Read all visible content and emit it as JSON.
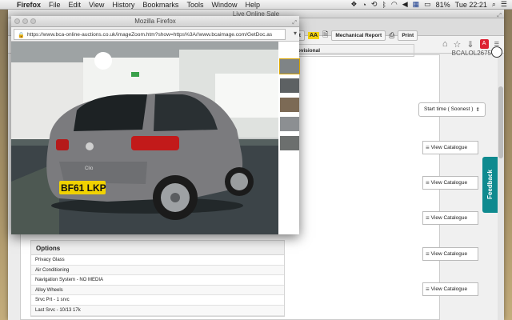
{
  "menubar": {
    "app": "Firefox",
    "items": [
      "File",
      "Edit",
      "View",
      "History",
      "Bookmarks",
      "Tools",
      "Window",
      "Help"
    ],
    "battery": "81%",
    "clock": "Tue 22:21"
  },
  "bg_window": {
    "title": "Live Online Sale",
    "reports": {
      "report_label": "Report",
      "aa_label": "AA",
      "mechanical_label": "Mechanical Report",
      "print_label": "Print"
    },
    "provisional_label": "Provisional",
    "user": "BCALOL2675",
    "sort": "Start time ( Soonest )",
    "catalogue_buttons": [
      "View Catalogue",
      "View Catalogue",
      "View Catalogue",
      "View Catalogue",
      "View Catalogue"
    ],
    "feedback": "Feedback",
    "options": {
      "title": "Options",
      "rows": [
        "Privacy Glass",
        "Air Conditioning",
        "Navigation System - NO MEDIA",
        "Alloy Wheels",
        "Srvc Prt - 1 srvc",
        "Last Srvc - 10/13 17k"
      ]
    }
  },
  "popup": {
    "title": "Mozilla Firefox",
    "url": "https://www.bca-online-auctions.co.uk/imageZoom.htm?show=https%3A//www.bcaimage.com/GetDoc.as",
    "plate": "BF61 LKP",
    "badge": "Clio"
  },
  "colors": {
    "feedback": "#0f8a8f",
    "car_body": "#7b7b7e",
    "plate": "#f1d200"
  }
}
